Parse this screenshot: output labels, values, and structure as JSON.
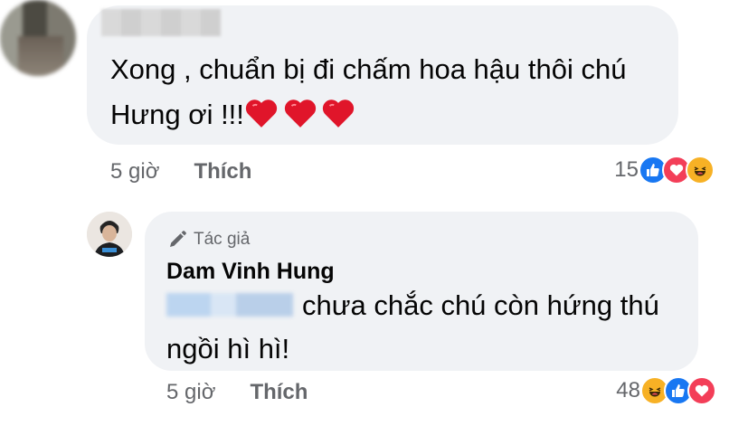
{
  "comment": {
    "text": "Xong , chuẩn bị đi chấm hoa hậu thôi chú Hưng ơi !!!",
    "time": "5 giờ",
    "like_label": "Thích",
    "reaction_count": "15",
    "reactions": [
      "like-icon",
      "love-icon",
      "haha-icon"
    ]
  },
  "reply": {
    "author_badge": "Tác giả",
    "author_name": "Dam Vinh Hung",
    "text": "chưa chắc chú còn hứng thú ngồi hì hì!",
    "time": "5 giờ",
    "like_label": "Thích",
    "reaction_count": "48",
    "reactions": [
      "haha-icon",
      "like-icon",
      "love-icon"
    ]
  },
  "colors": {
    "bubble": "#f0f2f5",
    "meta_text": "#65676b",
    "like_blue": "#1877f2",
    "love_red": "#f33e58",
    "haha_yellow": "#f7b125",
    "heart_emoji": "#e0152a"
  }
}
